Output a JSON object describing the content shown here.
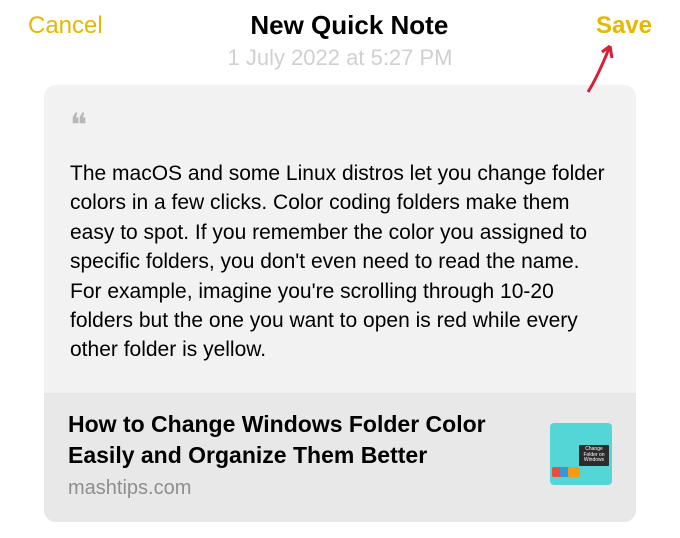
{
  "header": {
    "cancel_label": "Cancel",
    "title": "New Quick Note",
    "save_label": "Save"
  },
  "timestamp": "1 July 2022 at 5:27 PM",
  "note": {
    "quote_text": "The macOS and some Linux distros let you change folder colors in a few clicks. Color coding folders make them easy to spot. If you remember the color you assigned to specific folders, you don't even need to read the name. For example, imagine you're scrolling through 10-20 folders but the one you want to open is red while every other folder is yellow."
  },
  "link": {
    "title": "How to Change Windows Folder Color Easily and Organize Them Better",
    "source": "mashtips.com",
    "thumb_label": "Change Folder on Windows"
  },
  "colors": {
    "accent": "#e6b800",
    "annotation": "#d91e3a"
  }
}
